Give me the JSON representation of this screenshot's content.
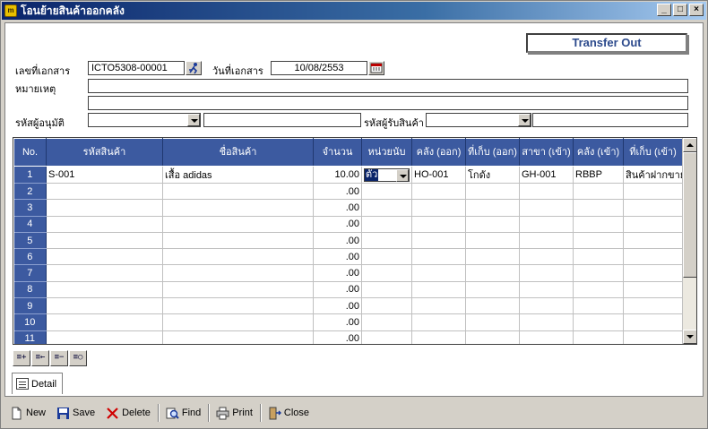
{
  "window": {
    "title": "โอนย้ายสินค้าออกคลัง"
  },
  "header": {
    "transfer_title": "Transfer Out",
    "doc_no_label": "เลขที่เอกสาร",
    "doc_no": "ICTO5308-00001",
    "doc_date_label": "วันที่เอกสาร",
    "doc_date": "10/08/2553",
    "remark_label": "หมายเหตุ",
    "approver_label": "รหัสผู้อนุมัติ",
    "receiver_label": "รหัสผู้รับสินค้า"
  },
  "grid": {
    "columns": [
      "No.",
      "รหัสสินค้า",
      "ชื่อสินค้า",
      "จำนวน",
      "หน่วยนับ",
      "คลัง (ออก)",
      "ที่เก็บ (ออก)",
      "สาขา (เข้า)",
      "คลัง (เข้า)",
      "ที่เก็บ (เข้า)"
    ],
    "rows": [
      {
        "no": "1",
        "code": "S-001",
        "name": "เสื้อ adidas",
        "qty": "10.00",
        "unit": "ตัว",
        "wh_out": "HO-001",
        "loc_out": "โกดัง",
        "branch_in": "GH-001",
        "wh_in": "RBBP",
        "loc_in": "สินค้าฝากขาย"
      },
      {
        "no": "2",
        "code": "",
        "name": "",
        "qty": ".00",
        "unit": "",
        "wh_out": "",
        "loc_out": "",
        "branch_in": "",
        "wh_in": "",
        "loc_in": ""
      },
      {
        "no": "3",
        "code": "",
        "name": "",
        "qty": ".00",
        "unit": "",
        "wh_out": "",
        "loc_out": "",
        "branch_in": "",
        "wh_in": "",
        "loc_in": ""
      },
      {
        "no": "4",
        "code": "",
        "name": "",
        "qty": ".00",
        "unit": "",
        "wh_out": "",
        "loc_out": "",
        "branch_in": "",
        "wh_in": "",
        "loc_in": ""
      },
      {
        "no": "5",
        "code": "",
        "name": "",
        "qty": ".00",
        "unit": "",
        "wh_out": "",
        "loc_out": "",
        "branch_in": "",
        "wh_in": "",
        "loc_in": ""
      },
      {
        "no": "6",
        "code": "",
        "name": "",
        "qty": ".00",
        "unit": "",
        "wh_out": "",
        "loc_out": "",
        "branch_in": "",
        "wh_in": "",
        "loc_in": ""
      },
      {
        "no": "7",
        "code": "",
        "name": "",
        "qty": ".00",
        "unit": "",
        "wh_out": "",
        "loc_out": "",
        "branch_in": "",
        "wh_in": "",
        "loc_in": ""
      },
      {
        "no": "8",
        "code": "",
        "name": "",
        "qty": ".00",
        "unit": "",
        "wh_out": "",
        "loc_out": "",
        "branch_in": "",
        "wh_in": "",
        "loc_in": ""
      },
      {
        "no": "9",
        "code": "",
        "name": "",
        "qty": ".00",
        "unit": "",
        "wh_out": "",
        "loc_out": "",
        "branch_in": "",
        "wh_in": "",
        "loc_in": ""
      },
      {
        "no": "10",
        "code": "",
        "name": "",
        "qty": ".00",
        "unit": "",
        "wh_out": "",
        "loc_out": "",
        "branch_in": "",
        "wh_in": "",
        "loc_in": ""
      },
      {
        "no": "11",
        "code": "",
        "name": "",
        "qty": ".00",
        "unit": "",
        "wh_out": "",
        "loc_out": "",
        "branch_in": "",
        "wh_in": "",
        "loc_in": ""
      }
    ]
  },
  "tabs": {
    "detail": "Detail"
  },
  "toolbar": {
    "new": "New",
    "save": "Save",
    "delete": "Delete",
    "find": "Find",
    "print": "Print",
    "close": "Close"
  },
  "colors": {
    "grid_header": "#3c5aa0",
    "title_accent": "#2c4a8c"
  }
}
